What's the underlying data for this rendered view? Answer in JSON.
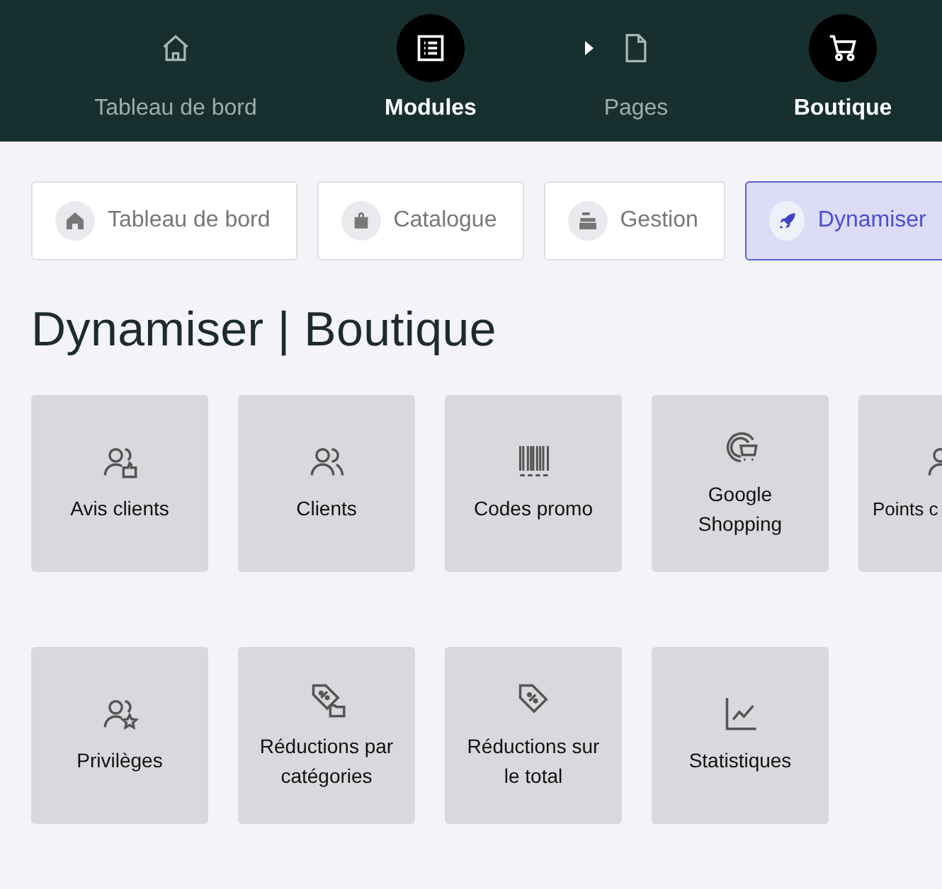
{
  "steps": [
    {
      "label": "Tableau de bord",
      "selected": false
    },
    {
      "label": "Modules",
      "selected": true
    },
    {
      "label": "Pages",
      "selected": false
    },
    {
      "label": "Boutique",
      "selected": true
    }
  ],
  "tabs": [
    {
      "label": "Tableau de bord",
      "selected": false
    },
    {
      "label": "Catalogue",
      "selected": false
    },
    {
      "label": "Gestion",
      "selected": false
    },
    {
      "label": "Dynamiser",
      "selected": true
    }
  ],
  "title": "Dynamiser | Boutique",
  "modules": [
    {
      "label": "Avis clients"
    },
    {
      "label": "Clients"
    },
    {
      "label": "Codes promo"
    },
    {
      "label": "Google Shopping"
    },
    {
      "label": "Points c"
    },
    {
      "label": "Privilèges"
    },
    {
      "label": "Réductions par catégories"
    },
    {
      "label": "Réductions sur le total"
    },
    {
      "label": "Statistiques"
    }
  ]
}
